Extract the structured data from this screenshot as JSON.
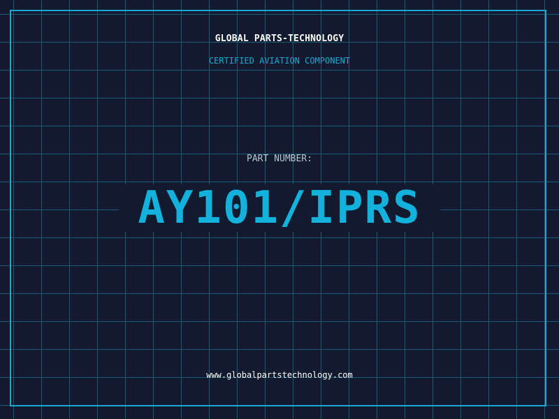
{
  "header": {
    "company": "GLOBAL PARTS-TECHNOLOGY",
    "subtitle": "CERTIFIED AVIATION COMPONENT"
  },
  "part": {
    "label": "PART NUMBER:",
    "number": "AY101/IPRS"
  },
  "footer": {
    "website": "www.globalpartstechnology.com"
  },
  "colors": {
    "background": "#111a2e",
    "grid": "#206e8a",
    "accent": "#1aa8d4",
    "part_number": "#12b2dd",
    "label": "#b8c4d0",
    "text": "#ffffff"
  }
}
